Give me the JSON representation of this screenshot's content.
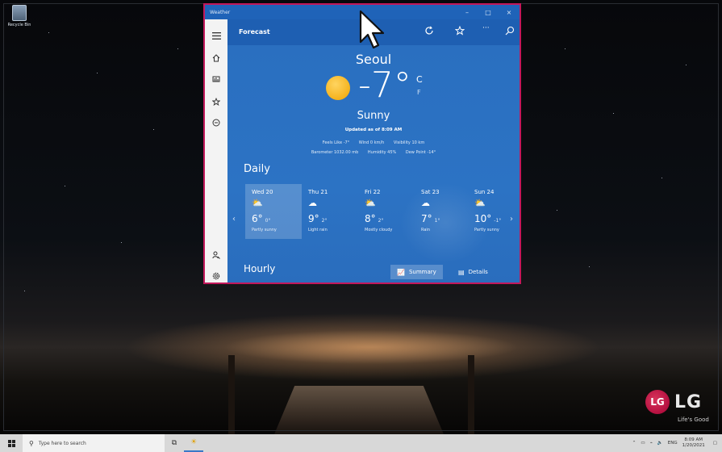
{
  "desktop": {
    "recycle_bin_label": "Recycle Bin",
    "brand": {
      "logo_letters": "LG",
      "wordmark": "LG",
      "tagline": "Life's Good",
      "color": "#a50034"
    }
  },
  "window": {
    "title": "Weather",
    "controls": {
      "minimize": "–",
      "maximize": "□",
      "close": "×"
    },
    "toolbar": {
      "tab": "Forecast",
      "refresh_icon": "refresh-icon",
      "favorite_icon": "star-icon",
      "more": "···",
      "search_icon": "search-icon"
    },
    "sidebar": {
      "menu_icon": "hamburger-icon",
      "items": [
        "home-icon",
        "maps-icon",
        "favorites-icon",
        "news-icon"
      ],
      "bottom": [
        "account-icon",
        "settings-icon"
      ]
    },
    "accent": "#2b6fbf"
  },
  "current": {
    "city": "Seoul",
    "temperature": "-7°",
    "unit_c": "C",
    "unit_f": "F",
    "condition": "Sunny",
    "updated": "Updated as of 8:09 AM",
    "row1": [
      "Feels Like  -7°",
      "Wind  0 km/h",
      "Visibility  10 km"
    ],
    "row2": [
      "Barometer  1032.00 mb",
      "Humidity  45%",
      "Dew Point  -14°"
    ]
  },
  "daily": {
    "title": "Daily",
    "days": [
      {
        "name": "Wed 20",
        "icon": "partly-sunny-icon",
        "hi": "6°",
        "lo": "0°",
        "desc": "Partly sunny",
        "selected": true
      },
      {
        "name": "Thu 21",
        "icon": "light-rain-icon",
        "hi": "9°",
        "lo": "2°",
        "desc": "Light rain",
        "selected": false
      },
      {
        "name": "Fri 22",
        "icon": "mostly-cloudy-icon",
        "hi": "8°",
        "lo": "2°",
        "desc": "Mostly cloudy",
        "selected": false
      },
      {
        "name": "Sat 23",
        "icon": "rain-icon",
        "hi": "7°",
        "lo": "1°",
        "desc": "Rain",
        "selected": false
      },
      {
        "name": "Sun 24",
        "icon": "partly-sunny-icon",
        "hi": "10°",
        "lo": "-1°",
        "desc": "Partly sunny",
        "selected": false
      }
    ]
  },
  "hourly": {
    "title": "Hourly",
    "summary_button": "Summary",
    "details_button": "Details"
  },
  "taskbar": {
    "search_placeholder": "Type here to search",
    "language": "ENG",
    "time": "8:09 AM",
    "date": "1/20/2021"
  }
}
